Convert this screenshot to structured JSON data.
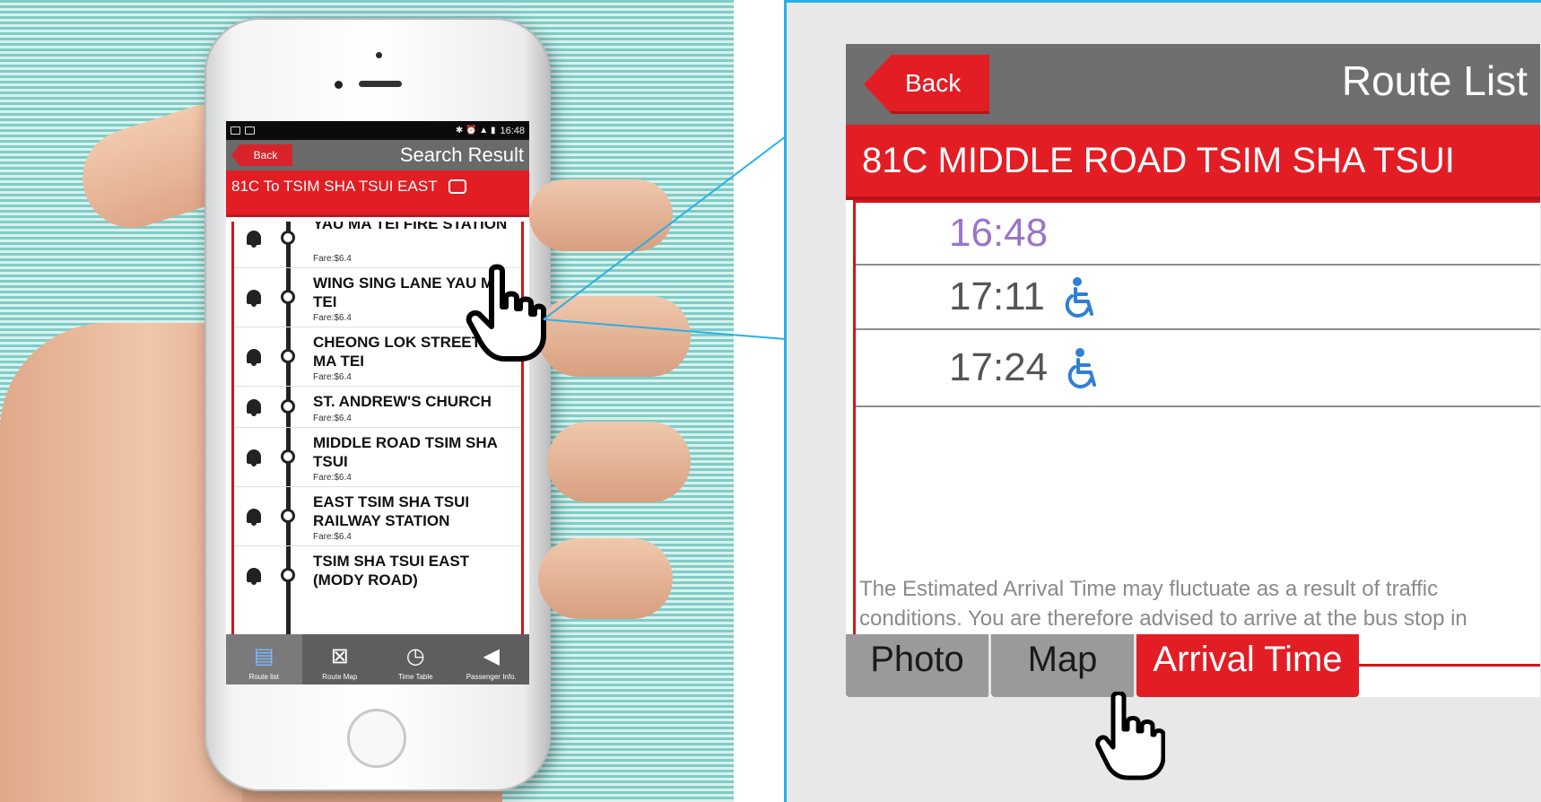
{
  "phone": {
    "status_time": "16:48",
    "back_label": "Back",
    "title": "Search Result",
    "route_header": "81C To TSIM SHA TSUI EAST",
    "stops": [
      {
        "name": "YAU MA TEI FIRE STATION",
        "fare": "Fare:$6.4"
      },
      {
        "name": "WING SING LANE YAU MA TEI",
        "fare": "Fare:$6.4"
      },
      {
        "name": "CHEONG LOK STREET YAU MA TEI",
        "fare": "Fare:$6.4"
      },
      {
        "name": "ST. ANDREW'S CHURCH",
        "fare": "Fare:$6.4"
      },
      {
        "name": "MIDDLE ROAD TSIM SHA TSUI",
        "fare": "Fare:$6.4"
      },
      {
        "name": "EAST TSIM SHA TSUI RAILWAY STATION",
        "fare": "Fare:$6.4"
      },
      {
        "name": "TSIM SHA TSUI EAST (MODY ROAD)",
        "fare": ""
      }
    ],
    "tabs": [
      {
        "label": "Route list",
        "icon": "clipboard-icon"
      },
      {
        "label": "Route Map",
        "icon": "route-map-icon"
      },
      {
        "label": "Time Table",
        "icon": "clock-icon"
      },
      {
        "label": "Passenger Info.",
        "icon": "megaphone-icon"
      }
    ]
  },
  "zoom": {
    "back_label": "Back",
    "title": "Route List",
    "route": "81C MIDDLE ROAD TSIM SHA TSUI",
    "times": [
      {
        "time": "16:48",
        "accessible": false
      },
      {
        "time": "17:11",
        "accessible": true
      },
      {
        "time": "17:24",
        "accessible": true
      }
    ],
    "notice": "The Estimated Arrival Time may fluctuate as a result of traffic conditions. You are therefore advised to arrive at the bus stop in advance.",
    "tabs": {
      "photo": "Photo",
      "map": "Map",
      "arrival": "Arrival Time"
    }
  },
  "colors": {
    "brand_red": "#e31d24",
    "header_gray": "#6f6f6f",
    "accent_blue": "#28b0e6",
    "first_time_purple": "#9b74c9"
  }
}
